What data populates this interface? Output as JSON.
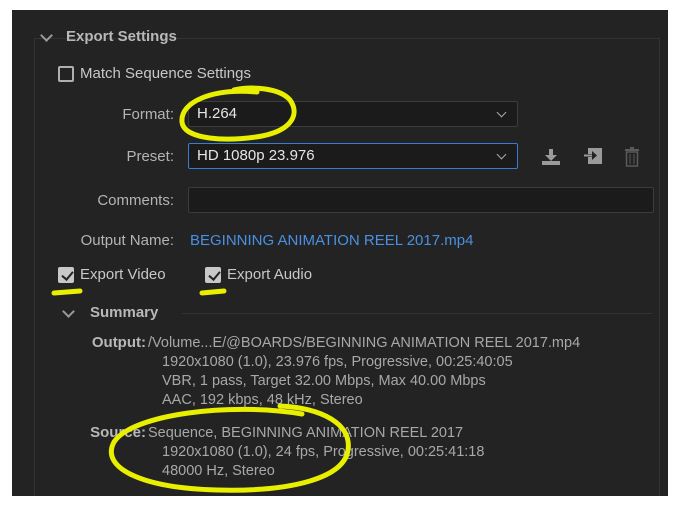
{
  "export_settings": {
    "title": "Export Settings",
    "match_sequence": {
      "label": "Match Sequence Settings",
      "checked": false
    },
    "format": {
      "label": "Format:",
      "value": "H.264"
    },
    "preset": {
      "label": "Preset:",
      "value": "HD 1080p 23.976"
    },
    "preset_icons": [
      "save-preset-icon",
      "import-preset-icon",
      "delete-preset-icon"
    ],
    "comments": {
      "label": "Comments:",
      "value": ""
    },
    "output_name": {
      "label": "Output Name:",
      "value": "BEGINNING ANIMATION REEL 2017.mp4"
    },
    "export_video": {
      "label": "Export Video",
      "checked": true
    },
    "export_audio": {
      "label": "Export Audio",
      "checked": true
    }
  },
  "summary": {
    "title": "Summary",
    "output": {
      "label": "Output:",
      "lines": [
        "/Volume...E/@BOARDS/BEGINNING ANIMATION REEL 2017.mp4",
        "1920x1080 (1.0), 23.976 fps, Progressive, 00:25:40:05",
        "VBR, 1 pass, Target 32.00 Mbps, Max 40.00 Mbps",
        "AAC, 192 kbps, 48 kHz, Stereo"
      ]
    },
    "source": {
      "label": "Source:",
      "lines": [
        "Sequence, BEGINNING ANIMATION REEL 2017",
        "1920x1080 (1.0), 24 fps, Progressive, 00:25:41:18",
        "48000 Hz, Stereo"
      ]
    }
  },
  "colors": {
    "panel_bg": "#232323",
    "link": "#4a90e2",
    "focus": "#3a7bd5",
    "annotation": "#e8f000"
  }
}
